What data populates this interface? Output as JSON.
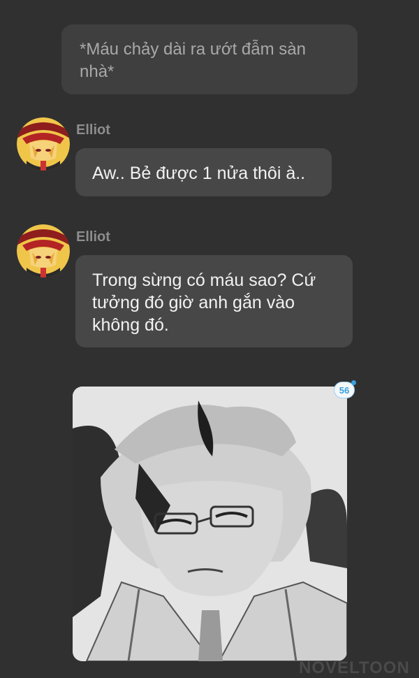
{
  "narration": {
    "text": "*Máu chảy dài ra ướt đẫm sàn nhà*"
  },
  "messages": [
    {
      "sender": "Elliot",
      "text": "Aw.. Bẻ được 1 nửa thôi à.."
    },
    {
      "sender": "Elliot",
      "text": "Trong sừng có máu sao? Cứ tưởng đó giờ anh gắn vào không đó."
    }
  ],
  "image_post": {
    "badge_count": "56"
  },
  "watermark": {
    "text": "NOVELTOON"
  },
  "colors": {
    "background": "#303030",
    "bubble": "#474747",
    "narration_bubble": "#3f3f3f",
    "sender_name": "#8d8d8d",
    "badge_accent": "#3aa0de"
  }
}
